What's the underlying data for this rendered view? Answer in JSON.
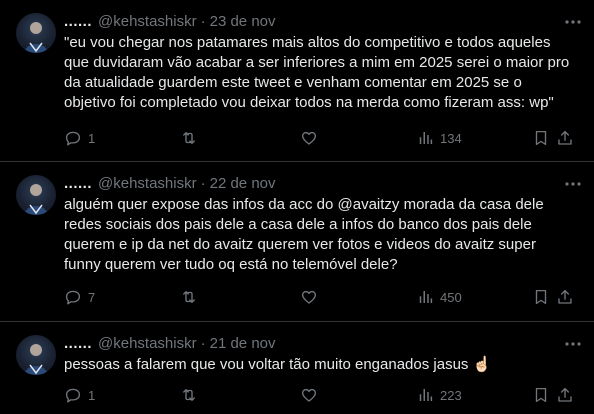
{
  "colors": {
    "background": "#000000",
    "text_primary": "#e7e9ea",
    "text_secondary": "#71767b",
    "divider": "#2f3336"
  },
  "tweets": [
    {
      "name": "......",
      "handle": "@kehstashiskr",
      "separator": "·",
      "date": "23 de nov",
      "text": "\"eu vou chegar nos patamares mais altos do competitivo e todos aqueles que duvidaram vão acabar a ser inferiores a mim em 2025 serei o maior pro da atualidade guardem este tweet e venham comentar em 2025 se o objetivo foi completado vou deixar todos na merda como fizeram ass: wp\"",
      "replies": "1",
      "retweets": "",
      "likes": "",
      "views": "134"
    },
    {
      "name": "......",
      "handle": "@kehstashiskr",
      "separator": "·",
      "date": "22 de nov",
      "text": "alguém quer expose das infos da acc do @avaitzy morada da casa dele redes sociais dos pais dele a casa dele a infos do banco dos pais dele querem e ip da net do avaitz querem ver fotos e videos do avaitz super funny querem ver tudo oq está no telemóvel dele?",
      "replies": "7",
      "retweets": "",
      "likes": "",
      "views": "450"
    },
    {
      "name": "......",
      "handle": "@kehstashiskr",
      "separator": "·",
      "date": "21 de nov",
      "text": "pessoas a falarem que vou voltar tão muito enganados jasus ☝🏻",
      "replies": "1",
      "retweets": "",
      "likes": "",
      "views": "223"
    }
  ],
  "icons": {
    "more": "more-dots-icon",
    "reply": "reply-bubble-icon",
    "retweet": "retweet-arrows-icon",
    "like": "heart-icon",
    "views": "views-bar-chart-icon",
    "bookmark": "bookmark-icon",
    "share": "share-upload-icon"
  }
}
